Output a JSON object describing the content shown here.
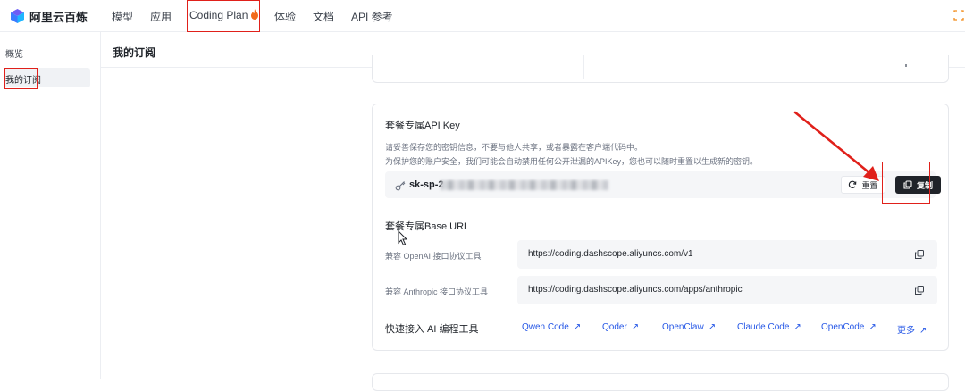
{
  "nav": {
    "brand": "阿里云百炼",
    "items": [
      "模型",
      "应用",
      "Coding Plan",
      "体验",
      "文档",
      "API 参考"
    ]
  },
  "sidebar": {
    "items": [
      "概览",
      "我的订阅"
    ],
    "active_index": 1
  },
  "main": {
    "title": "我的订阅"
  },
  "api_key": {
    "title": "套餐专属API Key",
    "desc_line1": "请妥善保存您的密钥信息，不要与他人共享，或者暴露在客户端代码中。",
    "desc_line2": "为保护您的账户安全，我们可能会自动禁用任何公开泄漏的APIKey，您也可以随时重置以生成新的密钥。",
    "key_prefix": "sk-sp-2",
    "reset_label": "重置",
    "copy_label": "复制"
  },
  "base_url": {
    "title": "套餐专属Base URL",
    "rows": [
      {
        "label": "兼容 OpenAI 接口协议工具",
        "url": "https://coding.dashscope.aliyuncs.com/v1"
      },
      {
        "label": "兼容 Anthropic 接口协议工具",
        "url": "https://coding.dashscope.aliyuncs.com/apps/anthropic"
      }
    ]
  },
  "tools": {
    "title": "快速接入 AI 编程工具",
    "links": [
      "Qwen Code",
      "Qoder",
      "OpenClaw",
      "Claude Code",
      "OpenCode",
      "更多"
    ]
  },
  "colors": {
    "link": "#2456e6",
    "highlight": "#e0201a",
    "dark_button": "#1f2329"
  }
}
